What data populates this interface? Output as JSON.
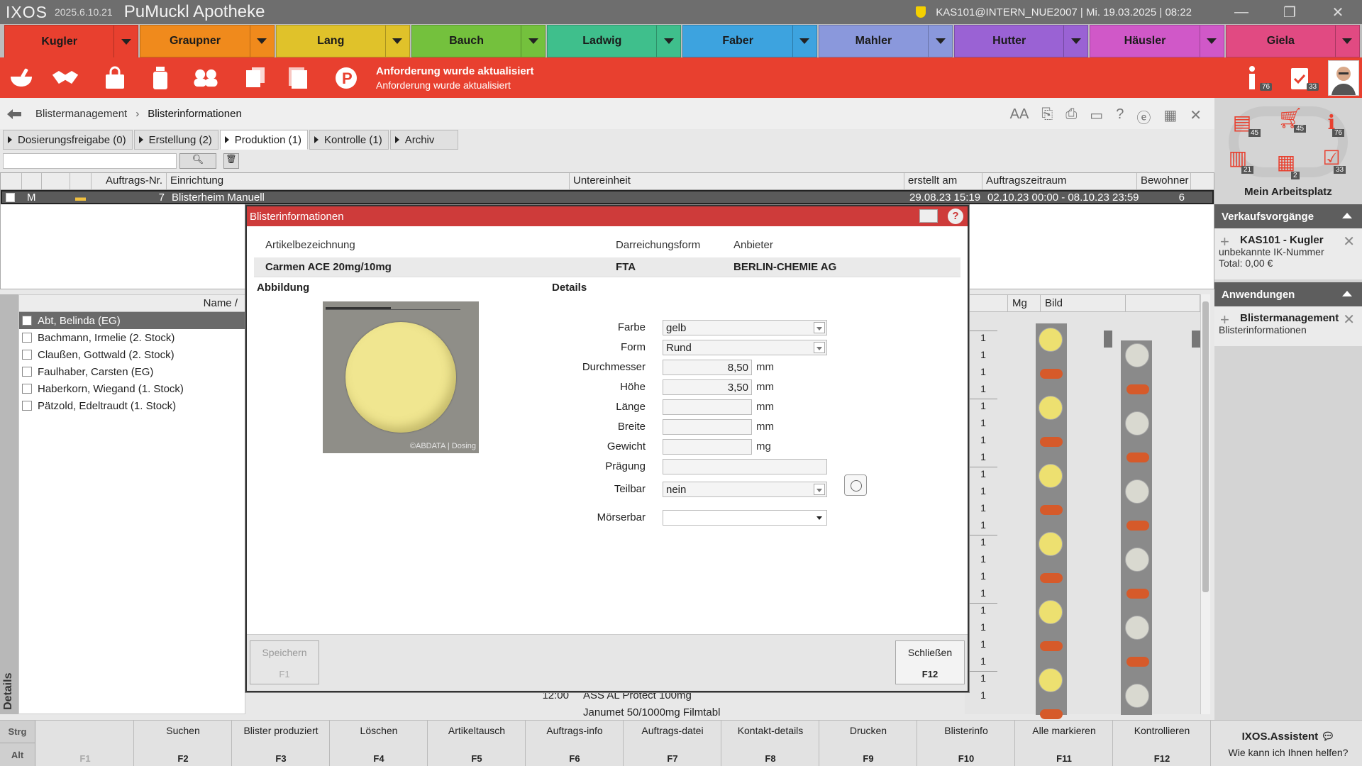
{
  "window": {
    "logo": "IXOS",
    "version": "2025.6.10.21",
    "app_name": "PuMuckl Apotheke",
    "session": "KAS101@INTERN_NUE2007  |  Mi. 19.03.2025  |  08:22"
  },
  "users": [
    {
      "name": "Kugler",
      "color": "#e8402f"
    },
    {
      "name": "Graupner",
      "color": "#f08a1c"
    },
    {
      "name": "Lang",
      "color": "#e0c22a"
    },
    {
      "name": "Bauch",
      "color": "#74c13d"
    },
    {
      "name": "Ladwig",
      "color": "#3fbf8c"
    },
    {
      "name": "Faber",
      "color": "#3da3df"
    },
    {
      "name": "Mahler",
      "color": "#8a98dc"
    },
    {
      "name": "Hutter",
      "color": "#9a62d4"
    },
    {
      "name": "Häusler",
      "color": "#d058c8"
    },
    {
      "name": "Giela",
      "color": "#e14a82"
    }
  ],
  "toolbar": {
    "message_title": "Anforderung wurde aktualisiert",
    "message_text": "Anforderung wurde aktualisiert",
    "info_badge": "76",
    "tasks_badge": "33"
  },
  "breadcrumb": {
    "item1": "Blistermanagement",
    "separator": "›",
    "item2": "Blisterinformationen"
  },
  "tabs": [
    {
      "label": "Dosierungsfreigabe (0)",
      "ul": "D"
    },
    {
      "label": "Erstellung (2)",
      "ul": "E"
    },
    {
      "label": "Produktion (1)",
      "ul": "P"
    },
    {
      "label": "Kontrolle (1)",
      "ul": "K"
    },
    {
      "label": "Archiv",
      "ul": "A"
    }
  ],
  "orders": {
    "headers": [
      "Auftrags-Nr.",
      "Einrichtung",
      "Untereinheit",
      "erstellt am",
      "Auftragszeitraum",
      "Bewohner"
    ],
    "row": {
      "mark": "M",
      "nr": "7",
      "einrichtung": "Blisterheim Manuell",
      "untereinheit": "",
      "erstellt": "29.08.23 15:19",
      "zeitraum": "02.10.23 00:00 - 08.10.23 23:59",
      "bewohner": "6"
    }
  },
  "patients": {
    "header": "Name /",
    "details_label": "Details",
    "items": [
      "Abt, Belinda (EG)",
      "Bachmann, Irmelie (2. Stock)",
      "Claußen, Gottwald (2. Stock)",
      "Faulhaber, Carsten (EG)",
      "Haberkorn, Wiegand (1. Stock)",
      "Pätzold, Edeltraudt (1. Stock)"
    ]
  },
  "blister": {
    "col_mg": "Mg",
    "col_bild": "Bild",
    "mg_values": [
      "1",
      "1",
      "1",
      "1",
      "1",
      "1",
      "1",
      "1",
      "1",
      "1",
      "1",
      "1",
      "1",
      "1",
      "1",
      "1",
      "1",
      "1",
      "1",
      "1",
      "1",
      "1"
    ],
    "bg_rows": [
      {
        "time": "12:00",
        "name": "ASS AL Protect 100mg"
      },
      {
        "time": "",
        "name": "Janumet 50/1000mg Filmtabl"
      }
    ]
  },
  "sidebar": {
    "workspace_label": "Mein Arbeitsplatz",
    "badges": {
      "b1": "45",
      "b2": "45",
      "b3": "76",
      "b4": "21",
      "b5": "2",
      "b6": "33"
    },
    "sales_header": "Verkaufsvorgänge",
    "sales_title": "KAS101 - Kugler",
    "sales_line1": "unbekannte IK-Nummer",
    "sales_line2": "Total: 0,00 €",
    "apps_header": "Anwendungen",
    "app_title": "Blistermanagement",
    "app_sub": "Blisterinformationen"
  },
  "fkeys": {
    "mod1": "Strg",
    "mod2": "Alt",
    "keys": [
      {
        "label": "",
        "key": "F1",
        "disabled": true
      },
      {
        "label": "Suchen",
        "key": "F2"
      },
      {
        "label": "Blister produziert",
        "key": "F3"
      },
      {
        "label": "Löschen",
        "key": "F4"
      },
      {
        "label": "Artikeltausch",
        "key": "F5"
      },
      {
        "label": "Auftrags-info",
        "key": "F6"
      },
      {
        "label": "Auftrags-datei",
        "key": "F7"
      },
      {
        "label": "Kontakt-details",
        "key": "F8"
      },
      {
        "label": "Drucken",
        "key": "F9"
      },
      {
        "label": "Blisterinfo",
        "key": "F10"
      },
      {
        "label": "Alle markieren",
        "key": "F11"
      },
      {
        "label": "Kontrollieren",
        "key": "F12"
      }
    ],
    "assistant_title": "IXOS.Assistent",
    "assistant_sub": "Wie kann ich Ihnen helfen?"
  },
  "modal": {
    "title": "Blisterinformationen",
    "col_article": "Artikelbezeichnung",
    "col_form": "Darreichungsform",
    "col_vendor": "Anbieter",
    "article": "Carmen ACE 20mg/10mg",
    "form": "FTA",
    "vendor": "BERLIN-CHEMIE AG",
    "section_image": "Abbildung",
    "section_details": "Details",
    "image_copyright": "©ABDATA | Dosing",
    "fields": {
      "farbe_label": "Farbe",
      "farbe": "gelb",
      "form_label": "Form",
      "form_val": "Rund",
      "durchmesser_label": "Durchmesser",
      "durchmesser": "8,50",
      "hoehe_label": "Höhe",
      "hoehe": "3,50",
      "laenge_label": "Länge",
      "laenge": "",
      "breite_label": "Breite",
      "breite": "",
      "gewicht_label": "Gewicht",
      "gewicht": "",
      "praegung_label": "Prägung",
      "praegung": "",
      "teilbar_label": "Teilbar",
      "teilbar": "nein",
      "moerserbar_label": "Mörserbar",
      "moerserbar": "",
      "unit_mm": "mm",
      "unit_mg": "mg"
    },
    "btn_save": "Speichern",
    "btn_save_key": "F1",
    "btn_close": "Schließen",
    "btn_close_key": "F12"
  }
}
